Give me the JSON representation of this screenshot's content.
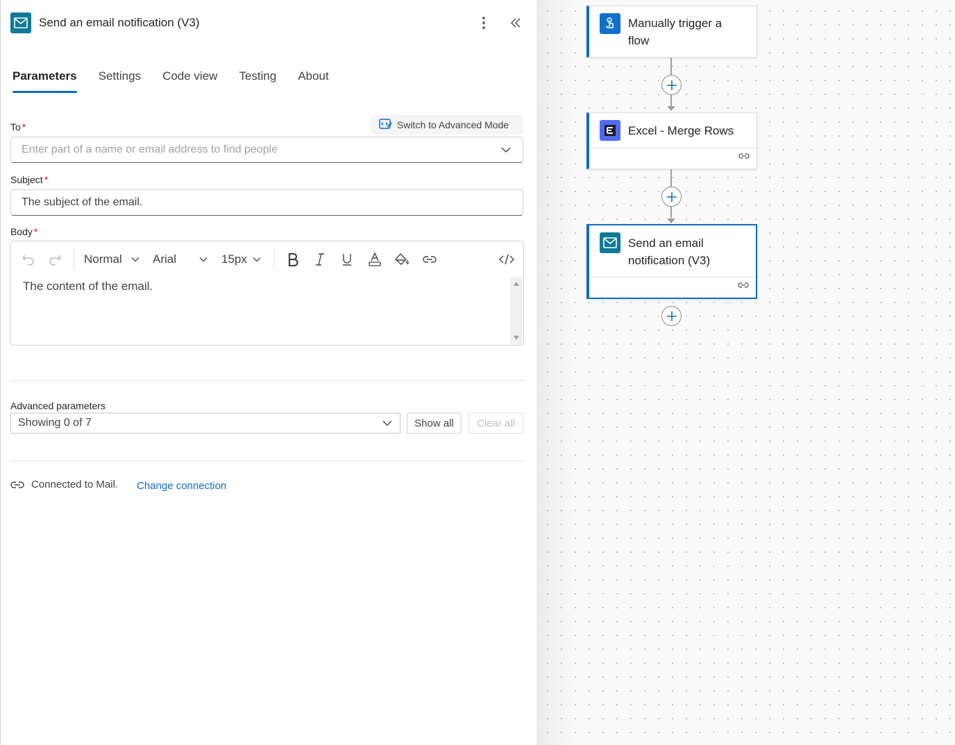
{
  "panel": {
    "title": "Send an email notification (V3)",
    "tabs": [
      {
        "label": "Parameters",
        "active": true
      },
      {
        "label": "Settings"
      },
      {
        "label": "Code view"
      },
      {
        "label": "Testing"
      },
      {
        "label": "About"
      }
    ],
    "advanced_mode_label": "Switch to Advanced Mode",
    "to": {
      "label": "To",
      "required_mark": "*",
      "placeholder": "Enter part of a name or email address to find people"
    },
    "subject": {
      "label": "Subject",
      "required_mark": "*",
      "value": "The subject of the email."
    },
    "body": {
      "label": "Body",
      "required_mark": "*",
      "paragraph_style": "Normal",
      "font": "Arial",
      "font_size": "15px",
      "content": "The content of the email."
    },
    "advanced": {
      "label": "Advanced parameters",
      "select_value": "Showing 0 of 7",
      "show_all": "Show all",
      "clear_all": "Clear all"
    },
    "connection": {
      "status": "Connected to Mail.",
      "change_link": "Change connection"
    }
  },
  "flow": {
    "steps": [
      {
        "title_line1": "Manually trigger a",
        "title_line2": "flow",
        "icon": "touch-trigger-icon",
        "color": "#1170cf"
      },
      {
        "title": "Excel - Merge Rows",
        "icon": "excel-icon",
        "color": "#4f6bed"
      },
      {
        "title_line1": "Send an email",
        "title_line2": "notification (V3)",
        "icon": "mail-icon",
        "color": "#0f7a97"
      }
    ]
  },
  "colors": {
    "accent": "#0f6cbd",
    "required": "#c50f1f"
  }
}
